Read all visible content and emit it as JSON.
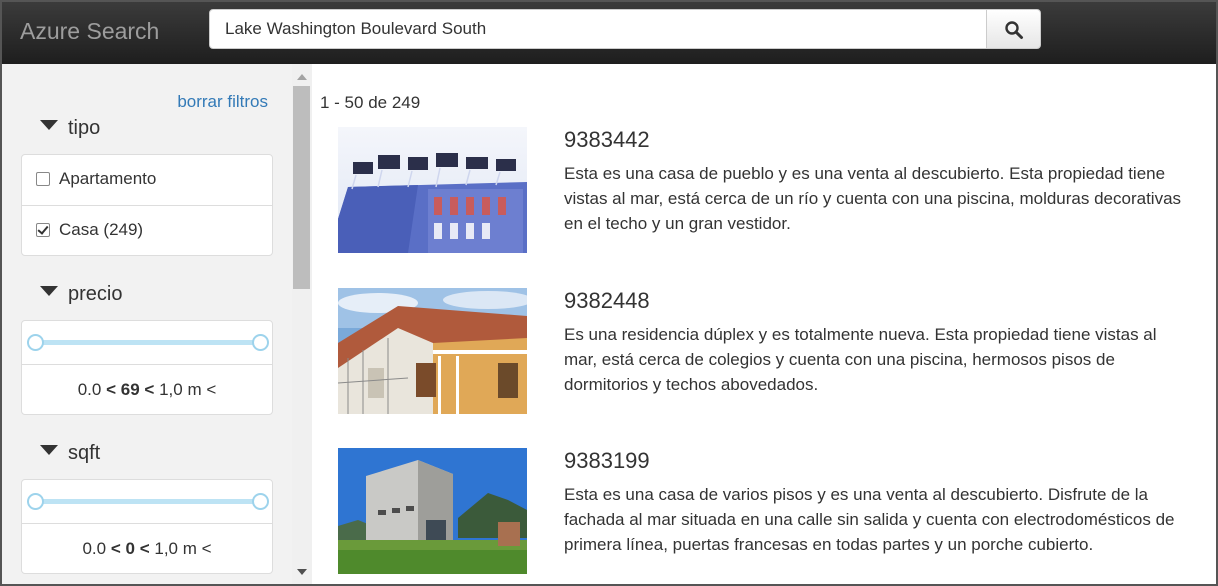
{
  "header": {
    "brand": "Azure Search",
    "search": {
      "value": "Lake Washington Boulevard South"
    }
  },
  "sidebar": {
    "clear_filters": "borrar filtros",
    "facets": {
      "tipo": {
        "title": "tipo",
        "options": [
          {
            "label": "Apartamento",
            "checked": false
          },
          {
            "label": "Casa (249)",
            "checked": true
          }
        ]
      },
      "precio": {
        "title": "precio",
        "range": {
          "low": "0.0",
          "value": "69",
          "high": "1,0 m"
        }
      },
      "sqft": {
        "title": "sqft",
        "range": {
          "low": "0.0",
          "value": "0",
          "high": "1,0 m"
        }
      }
    }
  },
  "results": {
    "count": "1 - 50 de 249",
    "items": [
      {
        "id": "9383442",
        "description": "Esta es una casa de pueblo y es una venta al descubierto. Esta propiedad tiene vistas al mar, está cerca de un río y cuenta con una piscina, molduras decorativas en el techo y un gran vestidor."
      },
      {
        "id": "9382448",
        "description": "Es una residencia dúplex y es totalmente nueva. Esta propiedad tiene vistas al mar, está cerca de colegios y cuenta con una piscina, hermosos pisos de dormitorios y techos abovedados."
      },
      {
        "id": "9383199",
        "description": "Esta es una casa de varios pisos y es una venta al descubierto. Disfrute de la fachada al mar situada en una calle sin salida y cuenta con electrodomésticos de primera línea, puertas francesas en todas partes y un porche cubierto."
      }
    ]
  },
  "colors": {
    "topbar": "#222222",
    "link": "#337ab7",
    "slider": "#9dd3ec",
    "sidebar_bg": "#f2f2f2"
  },
  "icons": [
    "search-icon",
    "caret-down-icon",
    "checkbox-icon"
  ]
}
